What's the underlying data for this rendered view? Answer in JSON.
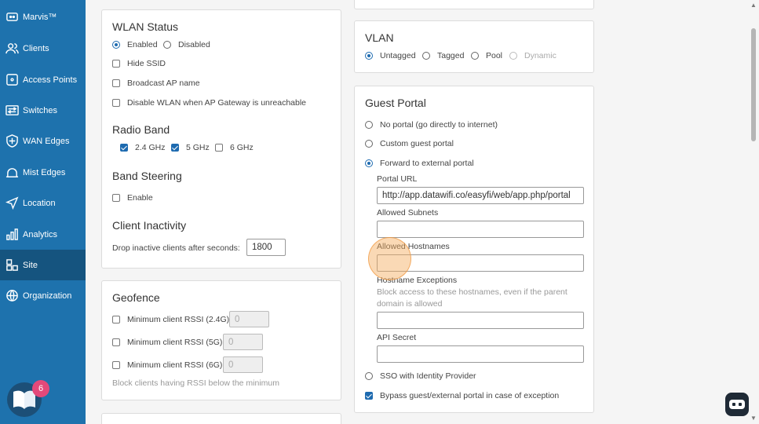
{
  "sidebar": {
    "items": [
      {
        "label": "Marvis™",
        "icon": "marvis-icon"
      },
      {
        "label": "Clients",
        "icon": "clients-icon"
      },
      {
        "label": "Access Points",
        "icon": "access-points-icon"
      },
      {
        "label": "Switches",
        "icon": "switches-icon"
      },
      {
        "label": "WAN Edges",
        "icon": "wan-edges-icon"
      },
      {
        "label": "Mist Edges",
        "icon": "mist-edges-icon"
      },
      {
        "label": "Location",
        "icon": "location-icon"
      },
      {
        "label": "Analytics",
        "icon": "analytics-icon"
      },
      {
        "label": "Site",
        "icon": "site-icon"
      },
      {
        "label": "Organization",
        "icon": "organization-icon"
      }
    ],
    "active": "Site",
    "help_badge": "6"
  },
  "wlan_status": {
    "title": "WLAN Status",
    "enabled_label": "Enabled",
    "disabled_label": "Disabled",
    "hide_ssid_label": "Hide SSID",
    "broadcast_ap_label": "Broadcast AP name",
    "disable_wlan_label": "Disable WLAN when AP Gateway is unreachable"
  },
  "radio_band": {
    "title": "Radio Band",
    "band_24": "2.4 GHz",
    "band_5": "5 GHz",
    "band_6": "6 GHz"
  },
  "band_steering": {
    "title": "Band Steering",
    "enable_label": "Enable"
  },
  "client_inactivity": {
    "title": "Client Inactivity",
    "drop_label": "Drop inactive clients after seconds:",
    "seconds_value": "1800"
  },
  "geofence": {
    "title": "Geofence",
    "rssi_24_label": "Minimum client RSSI (2.4G)",
    "rssi_24_value": "0",
    "rssi_5_label": "Minimum client RSSI (5G)",
    "rssi_5_value": "0",
    "rssi_6_label": "Minimum client RSSI (6G)",
    "rssi_6_value": "0",
    "hint": "Block clients having RSSI below the minimum"
  },
  "vlan": {
    "title": "VLAN",
    "untagged": "Untagged",
    "tagged": "Tagged",
    "pool": "Pool",
    "dynamic": "Dynamic"
  },
  "guest_portal": {
    "title": "Guest Portal",
    "no_portal": "No portal (go directly to internet)",
    "custom_portal": "Custom guest portal",
    "external_portal": "Forward to external portal",
    "portal_url_label": "Portal URL",
    "portal_url_value": "http://app.datawifi.co/easyfi/web/app.php/portal",
    "allowed_subnets_label": "Allowed Subnets",
    "allowed_hostnames_label": "Allowed Hostnames",
    "hostname_exceptions_label": "Hostname Exceptions",
    "hostname_exceptions_hint_1": "Block access to these hostnames, even if the parent",
    "hostname_exceptions_hint_2": "domain is allowed",
    "api_secret_label": "API Secret",
    "sso_label": "SSO with Identity Provider",
    "bypass_label": "Bypass guest/external portal in case of exception"
  }
}
